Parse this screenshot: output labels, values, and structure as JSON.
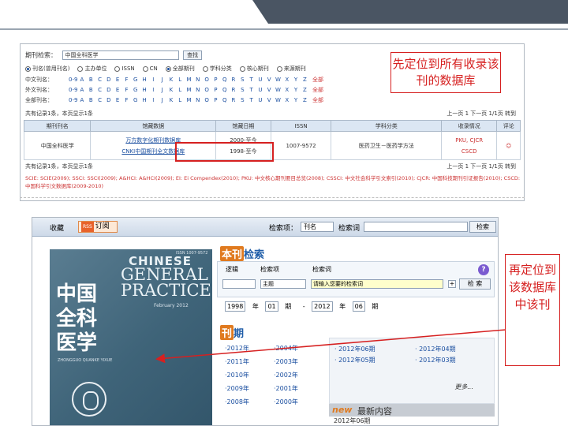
{
  "slide": {
    "callout_top": "先定位到所有收录该刊的数据库",
    "callout_bottom": "再定位到该数据库中该刊"
  },
  "shot1": {
    "search_label": "期刊检索：",
    "search_value": "中国全科医学",
    "search_button": "查找",
    "radios": [
      "刊名(曾用刊名)",
      "主办单位",
      "ISSN",
      "CN",
      "全部期刊",
      "学科分类",
      "核心期刊",
      "来源期刊"
    ],
    "alpha_rows": [
      {
        "label": "中文刊名：",
        "chars": [
          "0-9",
          "A",
          "B",
          "C",
          "D",
          "E",
          "F",
          "G",
          "H",
          "I",
          "J",
          "K",
          "L",
          "M",
          "N",
          "O",
          "P",
          "Q",
          "R",
          "S",
          "T",
          "U",
          "V",
          "W",
          "X",
          "Y",
          "Z"
        ],
        "all": "全部"
      },
      {
        "label": "外文刊名：",
        "chars": [
          "0-9",
          "A",
          "B",
          "C",
          "D",
          "E",
          "F",
          "G",
          "H",
          "I",
          "J",
          "K",
          "L",
          "M",
          "N",
          "O",
          "P",
          "Q",
          "R",
          "S",
          "T",
          "U",
          "V",
          "W",
          "X",
          "Y",
          "Z"
        ],
        "all": "全部"
      },
      {
        "label": "全部刊名：",
        "chars": [
          "0-9",
          "A",
          "B",
          "C",
          "D",
          "E",
          "F",
          "G",
          "H",
          "I",
          "J",
          "K",
          "L",
          "M",
          "N",
          "O",
          "P",
          "Q",
          "R",
          "S",
          "T",
          "U",
          "V",
          "W",
          "X",
          "Y",
          "Z"
        ],
        "all": "全部"
      }
    ],
    "result_count": "共有记录1条，本页显示1条",
    "pager_top": "上一页  1  下一页  1/1页 转到",
    "pager_bottom": "上一页  1  下一页  1/1页  转到",
    "table_headers": [
      "期刊刊名",
      "馆藏数据",
      "馆藏日期",
      "ISSN",
      "学科分类",
      "收录情况",
      "评论"
    ],
    "row": {
      "title": "中国全科医学",
      "holding1": "万方数字化期刊数据库",
      "holding2": "CNKI中国期刊全文数据库",
      "date1": "2000-至今",
      "date2": "1998-至今",
      "issn": "1007-9572",
      "subject": "医药卫生－医药学方法",
      "index1": "PKU, CJCR",
      "index2": "CSCD"
    },
    "footnote": "SCIE: SCIE(2009); SSCI: SSCI(2009); A&HCI: A&HCI(2009); EI: Ei Compendex(2010); PKU: 中文核心期刊要目总览(2008); CSSCI: 中文社会科学引文索引(2010); CJCR: 中国科技期刊引证报告(2010); CSCD: 中国科学引文数据库(2009-2010)"
  },
  "shot2": {
    "nav_tab": "收藏",
    "subscribe": "订阅",
    "rss": "RSS",
    "scope_label": "检索项：",
    "scope_value": "刊名",
    "keyword_label": "检索词",
    "search_button": "检索",
    "cover": {
      "line1": "CHINESE",
      "line2": "GENERAL",
      "line3": "PRACTICE",
      "issn": "ISSN 1007-9572",
      "date": "February 2012",
      "cn_title": "中国全科医学",
      "pinyin": "ZHONGGUO QUANKE YIXUE"
    },
    "section_search_hi": "本刊",
    "section_search": "检索",
    "col_logic": "逻辑",
    "col_field": "检索项",
    "col_term": "检索词",
    "logic_value": "",
    "field_value": "主题",
    "term_placeholder": "请输入您要的检索词",
    "search_go": "检 索",
    "year_from": "1998",
    "year_label": "年",
    "issue_from": "01",
    "issue_label": "期",
    "year_to": "2012",
    "issue_to": "06",
    "section_issue_hi": "刊",
    "section_issue": "期",
    "years_left": [
      "·2012年",
      "·2011年",
      "·2010年",
      "·2009年",
      "·2008年"
    ],
    "years_right": [
      "·2004年",
      "·2003年",
      "·2002年",
      "·2001年",
      "·2000年"
    ],
    "issues": [
      "· 2012年06期",
      "· 2012年04期",
      "· 2012年05期",
      "· 2012年03期"
    ],
    "more": "更多...",
    "new_badge": "new",
    "new_title": "最新内容",
    "new_issue": "2012年06期"
  }
}
